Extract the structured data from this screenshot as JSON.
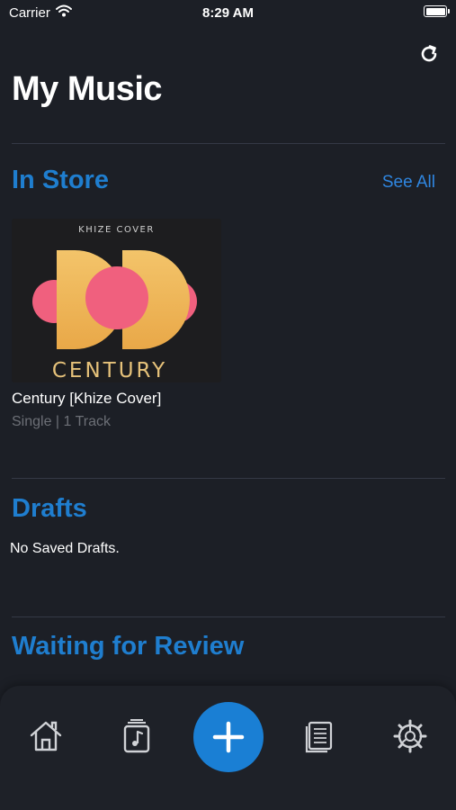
{
  "status_bar": {
    "carrier": "Carrier",
    "time": "8:29 AM"
  },
  "header": {
    "title": "My Music",
    "refresh_icon": "refresh-icon"
  },
  "in_store": {
    "title": "In Store",
    "see_all_label": "See All",
    "album": {
      "art_top_text": "KHIZE COVER",
      "art_bottom_text": "CENTURY",
      "title": "Century [Khize Cover]",
      "subtitle": "Single | 1 Track"
    }
  },
  "drafts": {
    "title": "Drafts",
    "empty_text": "No Saved Drafts."
  },
  "waiting": {
    "title": "Waiting for Review"
  },
  "tab_bar": {
    "items": [
      "home-icon",
      "music-library-icon",
      "add-icon",
      "document-list-icon",
      "settings-gear-icon"
    ]
  },
  "colors": {
    "background": "#1c1f26",
    "accent": "#1f7ecf",
    "link": "#2f86e0",
    "muted": "#6c6f76",
    "fab": "#1a7fd4"
  }
}
